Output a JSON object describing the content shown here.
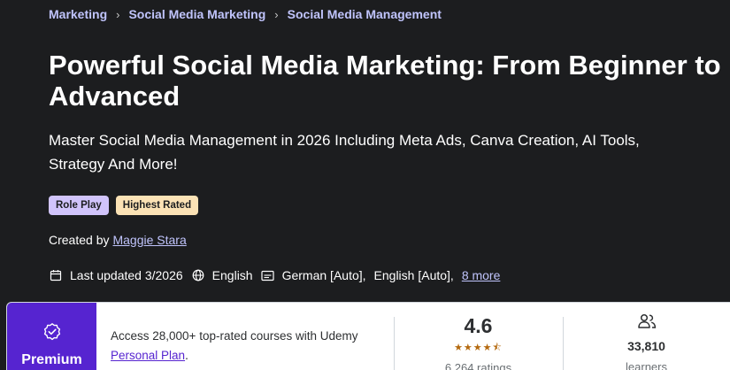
{
  "breadcrumb": {
    "items": [
      "Marketing",
      "Social Media Marketing",
      "Social Media Management"
    ],
    "separator": "›"
  },
  "course": {
    "title": "Powerful Social Media Marketing: From Beginner to Advanced",
    "subtitle": "Master Social Media Management in 2026 Including Meta Ads, Canva Creation, AI Tools, Strategy And More!",
    "badges": [
      "Role Play",
      "Highest Rated"
    ],
    "created_by_label": "Created by",
    "instructor": "Maggie Stara",
    "last_updated": "Last updated 3/2026",
    "language": "English",
    "captions": [
      "German [Auto],",
      "English [Auto],"
    ],
    "captions_more": "8 more"
  },
  "card": {
    "premium_label": "Premium",
    "access_text": "Access 28,000+ top-rated courses with Udemy",
    "plan_link": "Personal Plan",
    "plan_suffix": ".",
    "rating": "4.6",
    "stars": "★★★★⯪",
    "ratings_count": "6,264 ratings",
    "learners_count": "33,810",
    "learners_label": "learners"
  },
  "colors": {
    "background": "#1c1d1f",
    "link": "#c0c4fc",
    "premium": "#5624d0",
    "star": "#b4690e",
    "badge_role": "#d1c4fb",
    "badge_rated": "#fbe2b5"
  },
  "icons": [
    "chevron-right-icon",
    "calendar-icon",
    "globe-icon",
    "captions-icon",
    "premium-badge-icon",
    "learners-icon"
  ]
}
